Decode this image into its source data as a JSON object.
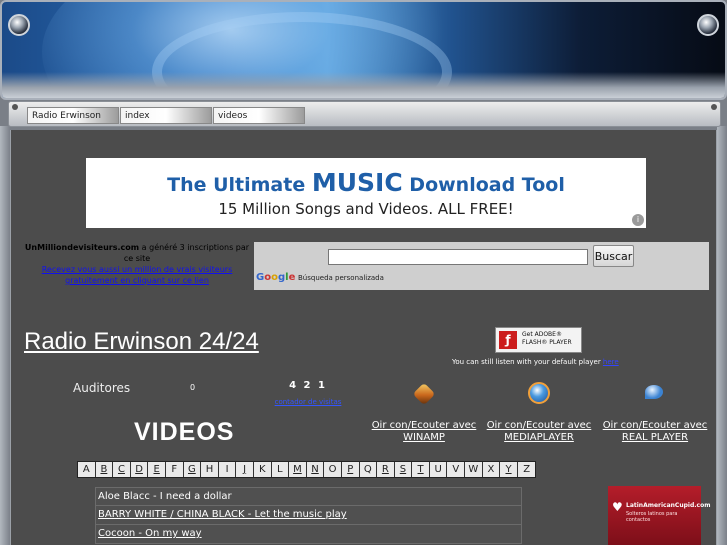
{
  "nav": {
    "tabs": [
      "Radio Erwinson",
      "index",
      "videos"
    ]
  },
  "ad": {
    "line1_pre": "The Ultimate ",
    "line1_big": "MUSIC",
    "line1_post": " Download Tool",
    "line2": "15 Million Songs and Videos. ALL FREE!",
    "info": "i"
  },
  "counter_box": {
    "brand": "UnMilliondevisiteurs.com",
    "text": " a généré 3 inscriptions par ce site",
    "link": "Recevez vous aussi un million de vrais visiteurs gratuitement en cliquant sur ce lien"
  },
  "search": {
    "button": "Buscar",
    "caption": "Búsqueda personalizada",
    "logo": [
      "G",
      "o",
      "o",
      "g",
      "l",
      "e"
    ]
  },
  "radio": {
    "title": "Radio Erwinson 24/24",
    "flash_line1": "Get ADOBE®",
    "flash_line2": "FLASH® PLAYER",
    "listen_text": "You can still listen with your default player ",
    "listen_link": "here"
  },
  "stats": {
    "label": "Auditores",
    "value": "0",
    "counter": "4 2 1",
    "counter_link": "contador de visitas"
  },
  "players": [
    {
      "icon": "winamp-icon",
      "line1": "Oir con/Ecouter avec",
      "line2": "WINAMP"
    },
    {
      "icon": "mediaplayer-icon",
      "line1": "Oir con/Ecouter avec",
      "line2": "MEDIAPLAYER"
    },
    {
      "icon": "realplayer-icon",
      "line1": "Oir con/Ecouter avec",
      "line2": "REAL PLAYER"
    }
  ],
  "videos": {
    "title": "VIDEOS",
    "letters": [
      "A",
      "B",
      "C",
      "D",
      "E",
      "F",
      "G",
      "H",
      "I",
      "J",
      "K",
      "L",
      "M",
      "N",
      "O",
      "P",
      "Q",
      "R",
      "S",
      "T",
      "U",
      "V",
      "W",
      "X",
      "Y",
      "Z"
    ],
    "items": [
      "Aloe Blacc - I need a dollar",
      "BARRY WHITE / CHINA BLACK - Let the music play",
      "Cocoon - On my way"
    ]
  },
  "side_banner": {
    "line1": "LatinAmericanCupid.com",
    "line2": "Solteros latinos para contactos"
  },
  "colors": {
    "background": "#4c4c4c",
    "link": "#1111ee",
    "ad_text": "#1f5fa8"
  }
}
